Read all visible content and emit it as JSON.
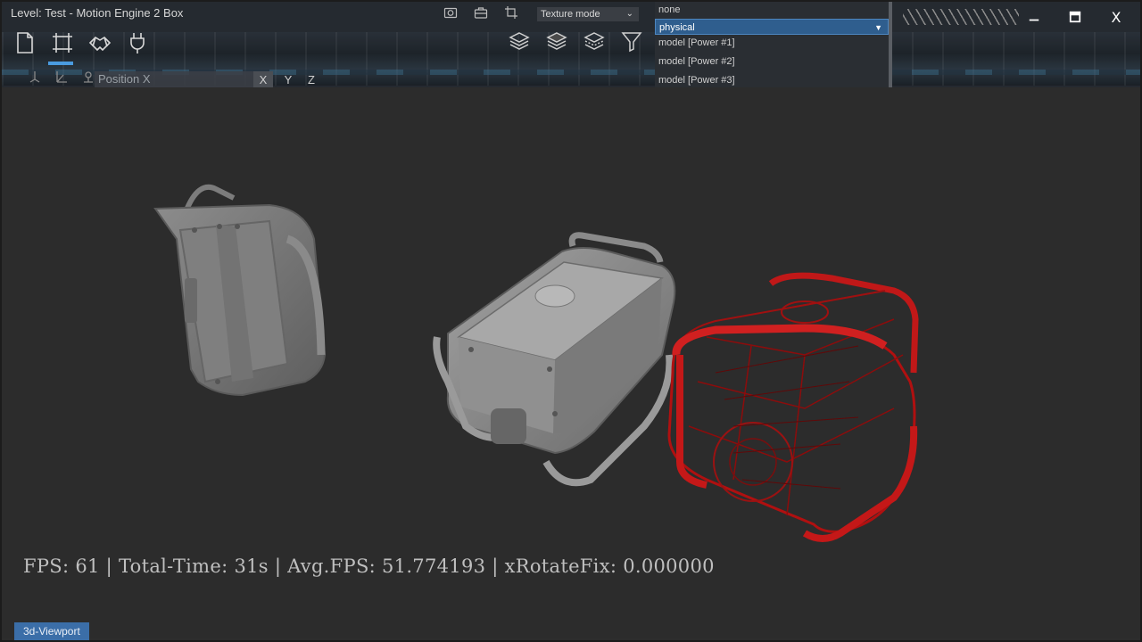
{
  "window": {
    "title": "Level: Test - Motion Engine 2 Box",
    "controls": {
      "minimize": "–",
      "maximize": "☐",
      "close": "X"
    }
  },
  "toolbar": {
    "main_icons": [
      "new-file-icon",
      "transform-select-icon",
      "handshake-icon",
      "plug-icon"
    ],
    "position_field": {
      "placeholder": "Position X"
    },
    "axes": [
      "X",
      "Y",
      "Z"
    ],
    "top_icons": [
      "camera-icon",
      "briefcase-icon",
      "crop-icon"
    ],
    "texture_mode": {
      "label": "Texture mode"
    },
    "layer_icons": [
      "layers-icon",
      "layers-alt-icon",
      "layers-stack-icon",
      "filter-icon"
    ]
  },
  "dropdown": {
    "options": [
      "none",
      "physical",
      "model [Power #1]",
      "model [Power #2]",
      "model [Power #3]"
    ],
    "selected_index": 1
  },
  "viewport": {
    "stats": "FPS: 61 | Total-Time: 31s | Avg.FPS: 51.774193 | xRotateFix: 0.000000",
    "tab_label": "3d-Viewport",
    "colors": {
      "background": "#2c2c2c",
      "wire_model": "#c01010",
      "solid_model": "#8a8a8a"
    }
  }
}
